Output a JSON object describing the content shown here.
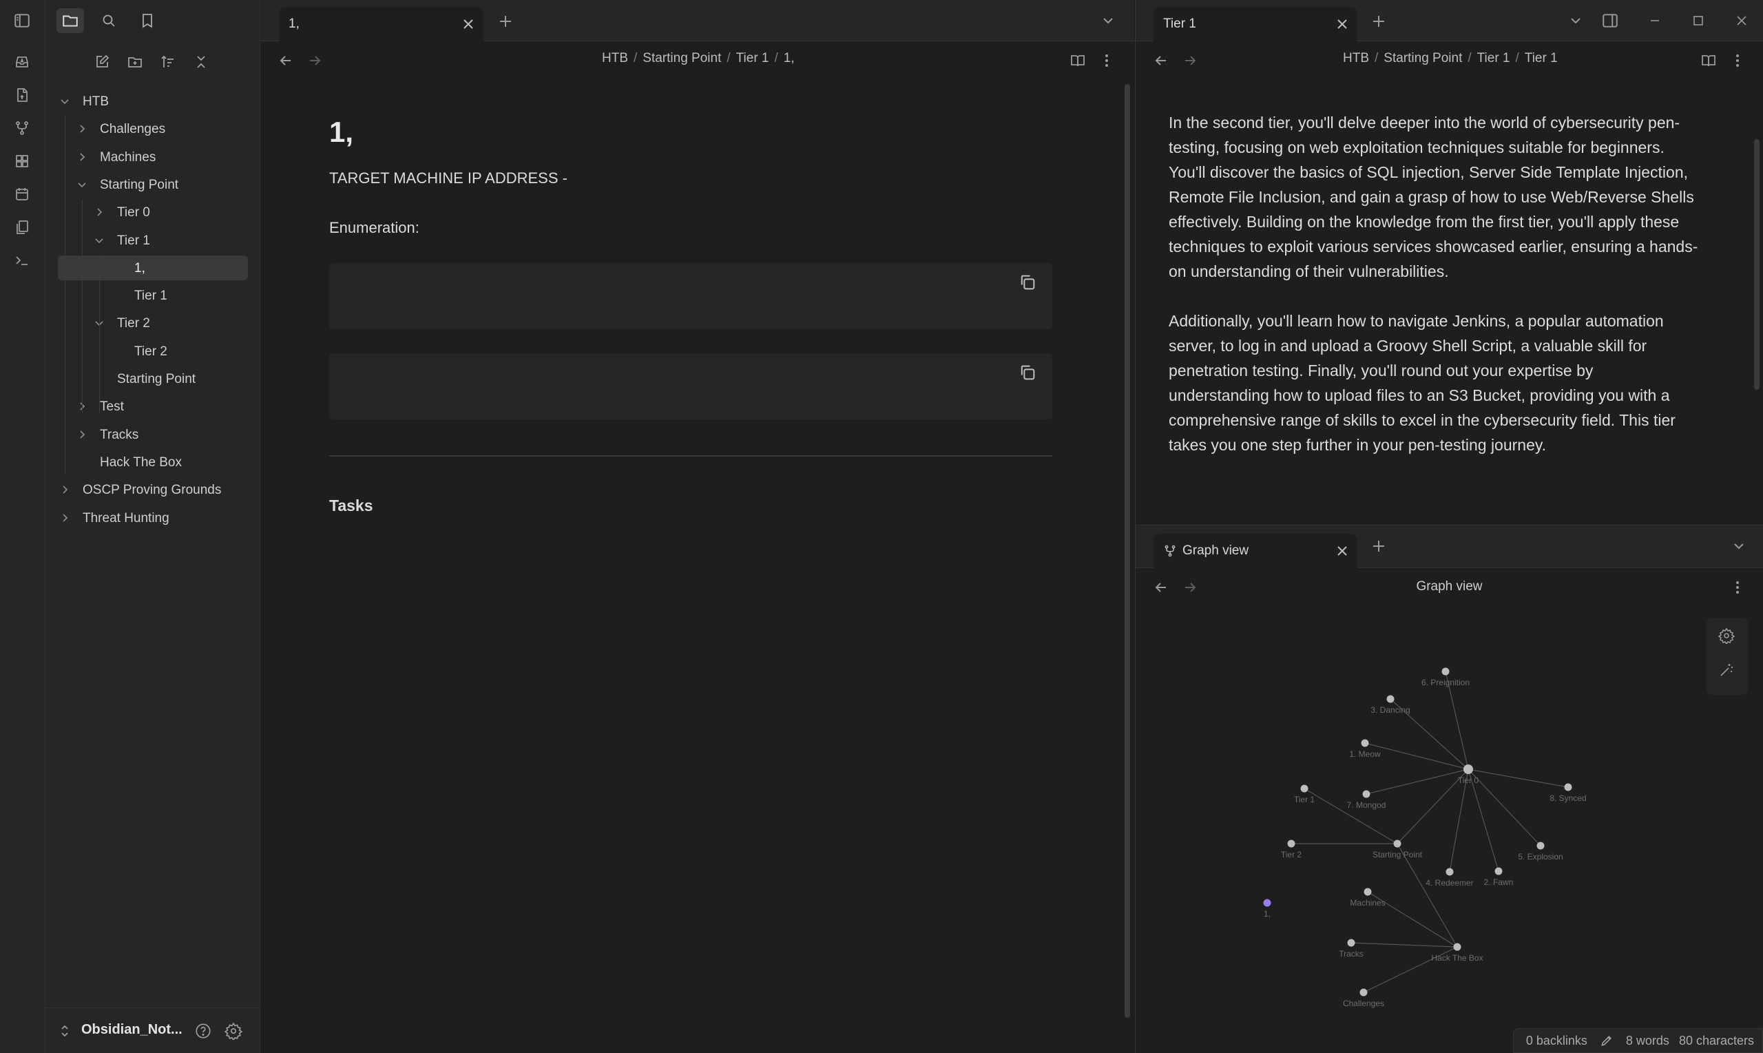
{
  "ribbon": {
    "icons": [
      "inbox-icon",
      "file-upload-icon",
      "git-branch-icon",
      "dashboard-icon",
      "calendar-icon",
      "copy-pages-icon",
      "terminal-icon"
    ]
  },
  "sidebar": {
    "top_icons": [
      "folder-icon",
      "search-icon",
      "bookmark-icon"
    ],
    "actions": [
      "new-note-icon",
      "new-folder-icon",
      "sort-icon",
      "collapse-all-icon"
    ],
    "tree": [
      {
        "label": "HTB",
        "level": 0,
        "expanded": true
      },
      {
        "label": "Challenges",
        "level": 1,
        "expanded": false
      },
      {
        "label": "Machines",
        "level": 1,
        "expanded": false
      },
      {
        "label": "Starting Point",
        "level": 1,
        "expanded": true
      },
      {
        "label": "Tier 0",
        "level": 2,
        "expanded": false
      },
      {
        "label": "Tier 1",
        "level": 2,
        "expanded": true
      },
      {
        "label": "1,",
        "level": 3,
        "selected": true
      },
      {
        "label": "Tier 1",
        "level": 3
      },
      {
        "label": "Tier 2",
        "level": 2,
        "expanded": true
      },
      {
        "label": "Tier 2",
        "level": 3
      },
      {
        "label": "Starting Point",
        "level": 2
      },
      {
        "label": "Test",
        "level": 1,
        "expanded": false
      },
      {
        "label": "Tracks",
        "level": 1,
        "expanded": false
      },
      {
        "label": "Hack The Box",
        "level": 1
      },
      {
        "label": "OSCP Proving Grounds",
        "level": 0,
        "expanded": false
      },
      {
        "label": "Threat Hunting",
        "level": 0,
        "expanded": false
      }
    ],
    "vault_name": "Obsidian_Not..."
  },
  "center": {
    "tab_title": "1,",
    "breadcrumb": [
      "HTB",
      "Starting Point",
      "Tier 1",
      "1,"
    ],
    "title": "1,",
    "line1": "TARGET MACHINE IP ADDRESS -",
    "line2": "Enumeration:",
    "tasks_heading": "Tasks"
  },
  "right": {
    "tab_title": "Tier 1",
    "breadcrumb": [
      "HTB",
      "Starting Point",
      "Tier 1",
      "Tier 1"
    ],
    "paragraph1_lines": [
      "In the second tier, you'll delve deeper into the world of cybersecurity pen-",
      "testing, focusing on web exploitation techniques suitable for beginners.",
      "You'll discover the basics of SQL injection, Server Side Template Injection,",
      "Remote File Inclusion, and gain a grasp of how to use Web/Reverse Shells",
      "effectively. Building on the knowledge from the first tier, you'll apply these",
      "techniques to exploit various services showcased earlier, ensuring a hands-",
      "on understanding of their vulnerabilities."
    ],
    "paragraph2_lines": [
      "Additionally, you'll learn how to navigate Jenkins, a popular automation",
      "server, to log in and upload a Groovy Shell Script, a valuable skill for",
      "penetration testing. Finally, you'll round out your expertise by",
      "understanding how to upload files to an S3 Bucket, providing you with a",
      "comprehensive range of skills to excel in the cybersecurity field. This tier",
      "takes you one step further in your pen-testing journey."
    ]
  },
  "graph": {
    "tab_title": "Graph view",
    "header_title": "Graph view",
    "nodes": [
      {
        "id": "preignition",
        "label": "6. Preignition"
      },
      {
        "id": "dancing",
        "label": "3. Dancing"
      },
      {
        "id": "meow",
        "label": "1. Meow"
      },
      {
        "id": "tier0",
        "label": "Tier 0"
      },
      {
        "id": "synced",
        "label": "8. Synced"
      },
      {
        "id": "tier1",
        "label": "Tier 1"
      },
      {
        "id": "mongod",
        "label": "7. Mongod"
      },
      {
        "id": "tier2",
        "label": "Tier 2"
      },
      {
        "id": "sp",
        "label": "Starting Point"
      },
      {
        "id": "explosion",
        "label": "5. Explosion"
      },
      {
        "id": "redeemer",
        "label": "4. Redeemer"
      },
      {
        "id": "fawn",
        "label": "2. Fawn"
      },
      {
        "id": "one",
        "label": "1,"
      },
      {
        "id": "machines",
        "label": "Machines"
      },
      {
        "id": "tracks",
        "label": "Tracks"
      },
      {
        "id": "htb",
        "label": "Hack The Box"
      },
      {
        "id": "challenges",
        "label": "Challenges"
      }
    ]
  },
  "status": {
    "backlinks": "0 backlinks",
    "words": "8 words",
    "characters": "80 characters"
  }
}
